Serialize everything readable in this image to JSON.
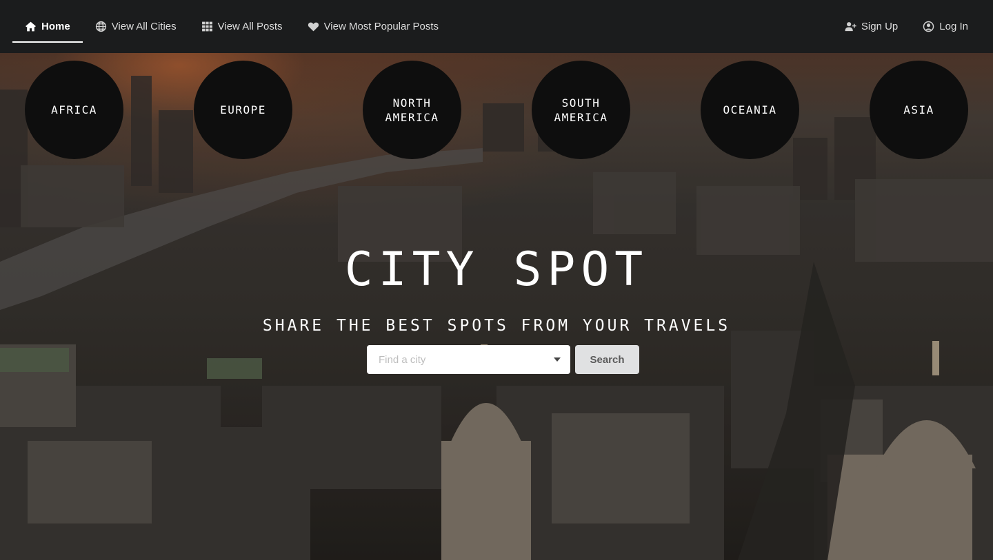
{
  "navbar": {
    "left": [
      {
        "label": "Home",
        "icon": "home-icon",
        "active": true
      },
      {
        "label": "View All Cities",
        "icon": "globe-icon",
        "active": false
      },
      {
        "label": "View All Posts",
        "icon": "grid-icon",
        "active": false
      },
      {
        "label": "View Most Popular Posts",
        "icon": "heart-icon",
        "active": false
      }
    ],
    "right": [
      {
        "label": "Sign Up",
        "icon": "add-user-icon"
      },
      {
        "label": "Log In",
        "icon": "user-circle-icon"
      }
    ]
  },
  "continents": [
    {
      "line1": "AFRICA",
      "line2": ""
    },
    {
      "line1": "EUROPE",
      "line2": ""
    },
    {
      "line1": "NORTH",
      "line2": "AMERICA"
    },
    {
      "line1": "SOUTH",
      "line2": "AMERICA"
    },
    {
      "line1": "OCEANIA",
      "line2": ""
    },
    {
      "line1": "ASIA",
      "line2": ""
    }
  ],
  "hero": {
    "title": "CITY SPOT",
    "subtitle": "SHARE THE BEST SPOTS FROM YOUR TRAVELS"
  },
  "search": {
    "placeholder": "Find a city",
    "button_label": "Search"
  },
  "colors": {
    "navbar_bg": "#1b1c1d",
    "circle_bg": "#0e0e0e",
    "button_bg": "#e0e1e2"
  }
}
